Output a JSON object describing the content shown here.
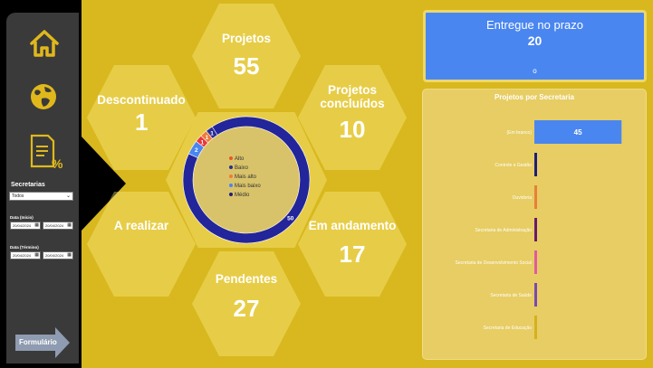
{
  "sidebar": {
    "nav": [
      {
        "name": "home-icon"
      },
      {
        "name": "globe-icon"
      },
      {
        "name": "report-percent-icon"
      }
    ],
    "secretarias_label": "Secretarias",
    "secretarias_value": "Todos",
    "date_start_label": "Data (Início)",
    "date_end_label": "Data (Término)",
    "date_start_from": "20/04/2024",
    "date_start_to": "20/04/2024",
    "date_end_from": "20/04/2024",
    "date_end_to": "20/04/2024",
    "form_button": "Formulário"
  },
  "hexes": {
    "projetos": {
      "title": "Projetos",
      "value": "55"
    },
    "descontinuado": {
      "title": "Descontinuado",
      "value": "1"
    },
    "concluidos": {
      "title": "Projetos concluídos",
      "value": "10"
    },
    "a_realizar": {
      "title": "A realizar",
      "value": ""
    },
    "em_andamento": {
      "title": "Em andamento",
      "value": "17"
    },
    "pendentes": {
      "title": "Pendentes",
      "value": "27"
    }
  },
  "kpi": {
    "title": "Entregue no prazo",
    "value": "20",
    "marker": "o"
  },
  "donut": {
    "legend": [
      {
        "label": "Alto",
        "color": "#e8572a"
      },
      {
        "label": "Baixo",
        "color": "#2a2d92"
      },
      {
        "label": "Mais alto",
        "color": "#f07a3a"
      },
      {
        "label": "Mais baixo",
        "color": "#4a86f0"
      },
      {
        "label": "Médio",
        "color": "#1e1f7a"
      }
    ]
  },
  "chart_data": [
    {
      "type": "pie",
      "title": "",
      "categories": [
        "Médio",
        "Mais baixo",
        "Alto",
        "Mais alto",
        "Baixo"
      ],
      "values": [
        50,
        2,
        1,
        1,
        1
      ],
      "colors": [
        "#23259a",
        "#4a86f0",
        "#e8373a",
        "#f07a3a",
        "#2a2d92"
      ],
      "data_labels": [
        "50",
        "2",
        "1",
        "1",
        "1"
      ],
      "donut": true
    },
    {
      "type": "bar",
      "orientation": "horizontal",
      "title": "Projetos por Secretaria",
      "categories": [
        "(Em branco)",
        "Controle e Gestão",
        "Ouvidoria",
        "Secretaria de Administração",
        "Secretaria de Desenvolvimento Social",
        "Secretaria de Saúde",
        "Secretaria de Educação"
      ],
      "values": [
        45,
        1,
        1,
        1,
        1,
        1,
        1
      ],
      "data_labels": [
        "45",
        "",
        "",
        "",
        "",
        "",
        ""
      ],
      "colors": [
        "#4a86f0",
        "#1e1f7a",
        "#e8803a",
        "#6a1a6a",
        "#e05aa0",
        "#7a4ab0",
        "#d4b020"
      ],
      "xlim": [
        0,
        50
      ]
    }
  ]
}
